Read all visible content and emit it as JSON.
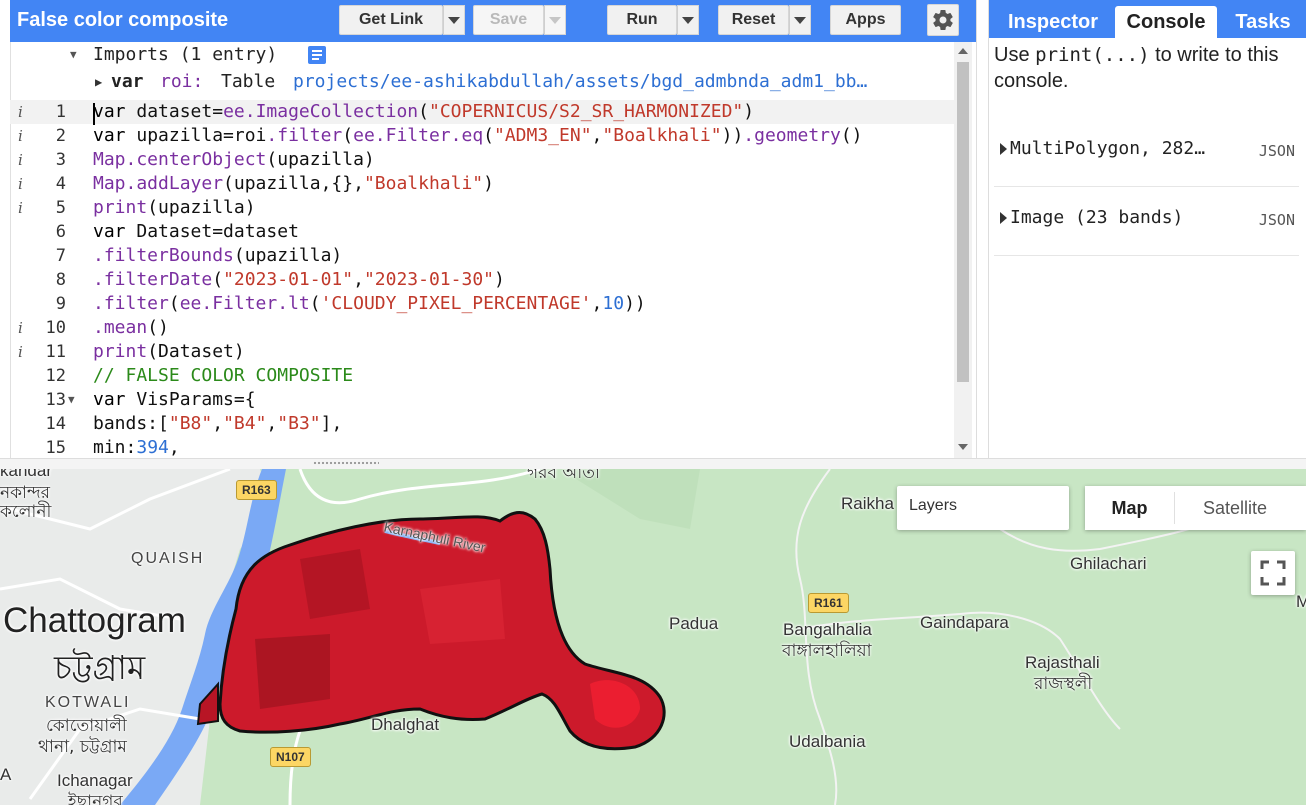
{
  "toolbar": {
    "title": "False color composite",
    "get_link": "Get Link",
    "save": "Save",
    "run": "Run",
    "reset": "Reset",
    "apps": "Apps"
  },
  "editor": {
    "imports_header": "Imports (1 entry)",
    "import_var": "var",
    "import_name": "roi:",
    "import_type": "Table",
    "import_path": "projects/ee-ashikabdullah/assets/bgd_admbnda_adm1_bb…",
    "line_numbers": [
      "1",
      "2",
      "3",
      "4",
      "5",
      "6",
      "7",
      "8",
      "9",
      "10",
      "11",
      "12",
      "13",
      "14",
      "15"
    ],
    "lines": [
      "var dataset=ee.ImageCollection(\"COPERNICUS/S2_SR_HARMONIZED\")",
      "var upazilla=roi.filter(ee.Filter.eq(\"ADM3_EN\",\"Boalkhali\")).geometry()",
      "Map.centerObject(upazilla)",
      "Map.addLayer(upazilla,{},\"Boalkhali\")",
      "print(upazilla)",
      "var Dataset=dataset",
      ".filterBounds(upazilla)",
      ".filterDate(\"2023-01-01\",\"2023-01-30\")",
      ".filter(ee.Filter.lt('CLOUDY_PIXEL_PERCENTAGE',10))",
      ".mean()",
      "print(Dataset)",
      "// FALSE COLOR COMPOSITE",
      "var VisParams={",
      "  bands:[\"B8\",\"B4\",\"B3\"],",
      "  min:394,"
    ]
  },
  "right_panel": {
    "tabs": [
      "Inspector",
      "Console",
      "Tasks"
    ],
    "active_tab": "Console",
    "console_hint_pre": "Use ",
    "console_hint_code": "print(...)",
    "console_hint_post": " to write to this console.",
    "items": [
      {
        "label": "MultiPolygon, 282…",
        "badge": "JSON"
      },
      {
        "label": "Image (23 bands)",
        "badge": "JSON"
      }
    ]
  },
  "map": {
    "layers_label": "Layers",
    "map_type_options": [
      "Map",
      "Satellite"
    ],
    "selected_map_type": "Map",
    "labels": {
      "chattogram": "Chattogram",
      "chattogram_bn": "চট্টগ্রাম",
      "quaish": "QUAISH",
      "kotwali": "KOTWALI",
      "kotwali_bn": "কোতোয়ালী",
      "kotwali_thana_bn": "থানা, চট্টগ্রাম",
      "ichanagar": "Ichanagar",
      "ichanagar_bn": "ইছানগর",
      "kandar": "kandar",
      "kandar_bn": "নকান্দর",
      "koloni_bn": "কলোনী",
      "karnaphuli": "Karnaphuli River",
      "dhalghat": "Dhalghat",
      "padua": "Padua",
      "bangalhalia": "Bangalhalia",
      "bangalhalia_bn": "বাঙ্গালহালিয়া",
      "gaindapara": "Gaindapara",
      "rajasthali": "Rajasthali",
      "rajasthali_bn": "রাজস্থলী",
      "udalbania": "Udalbania",
      "ghilachari": "Ghilachari",
      "raikha": "Raikha",
      "top_bn": "গরব আতা",
      "edge_m": "M",
      "edge_a": "A"
    },
    "roads": {
      "r163": "R163",
      "r161": "R161",
      "n107": "N107"
    },
    "colors": {
      "land": "#c8e6c4",
      "water": "#7aa9f5",
      "urban": "#e9ebea",
      "layer": "#cc1a2b"
    }
  }
}
